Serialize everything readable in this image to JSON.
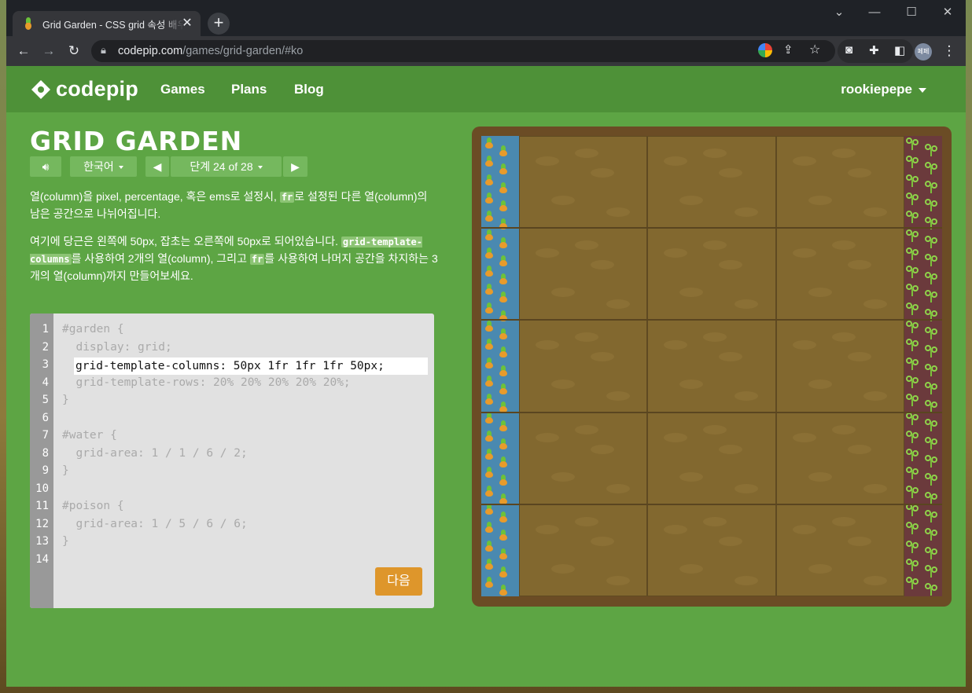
{
  "browser": {
    "tab_title": "Grid Garden - CSS grid 속성 배우기",
    "new_tab": "+",
    "close_tab": "✕",
    "url_host": "codepip.com",
    "url_path": "/games/grid-garden/#ko",
    "avatar_text": "페페"
  },
  "header": {
    "logo_text": "codepip",
    "nav": [
      "Games",
      "Plans",
      "Blog"
    ],
    "user": "rookiepepe"
  },
  "game": {
    "title": "GRID GARDEN",
    "language": "한국어",
    "level": "단계 24 of 28",
    "paragraph1": {
      "t1": "열(column)을 pixel, percentage, 혹은 ems로 설정시, ",
      "code1": "fr",
      "t2": "로 설정된 다른 열(column)의 남은 공간으로 나뉘어집니다."
    },
    "paragraph2": {
      "t1": "여기에 당근은 왼쪽에 50px, 잡초는 오른쪽에 50px로 되어있습니다. ",
      "code1": "grid-template-columns",
      "t2": "를 사용하여 2개의 열(column), 그리고 ",
      "code2": "fr",
      "t3": "를 사용하여 나머지 공간을 차지하는 3개의 열(column)까지 만들어보세요."
    }
  },
  "editor": {
    "line_numbers": [
      "1",
      "2",
      "3",
      "4",
      "5",
      "6",
      "7",
      "8",
      "9",
      "10",
      "11",
      "12",
      "13",
      "14"
    ],
    "lines": [
      "#garden {",
      "  display: grid;",
      "",
      "  grid-template-rows: 20% 20% 20% 20% 20%;",
      "}",
      "",
      "#water {",
      "  grid-area: 1 / 1 / 6 / 2;",
      "}",
      "",
      "#poison {",
      "  grid-area: 1 / 5 / 6 / 6;",
      "}",
      ""
    ],
    "input_value": "grid-template-columns: 50px 1fr 1fr 1fr 50px;",
    "next_button": "다음"
  },
  "garden": {
    "rows": 5,
    "columns": [
      "50px",
      "1fr",
      "1fr",
      "1fr",
      "50px"
    ],
    "water_color": "#4a89b0",
    "poison_color": "#6b3a3c",
    "soil_color": "#82682f"
  }
}
